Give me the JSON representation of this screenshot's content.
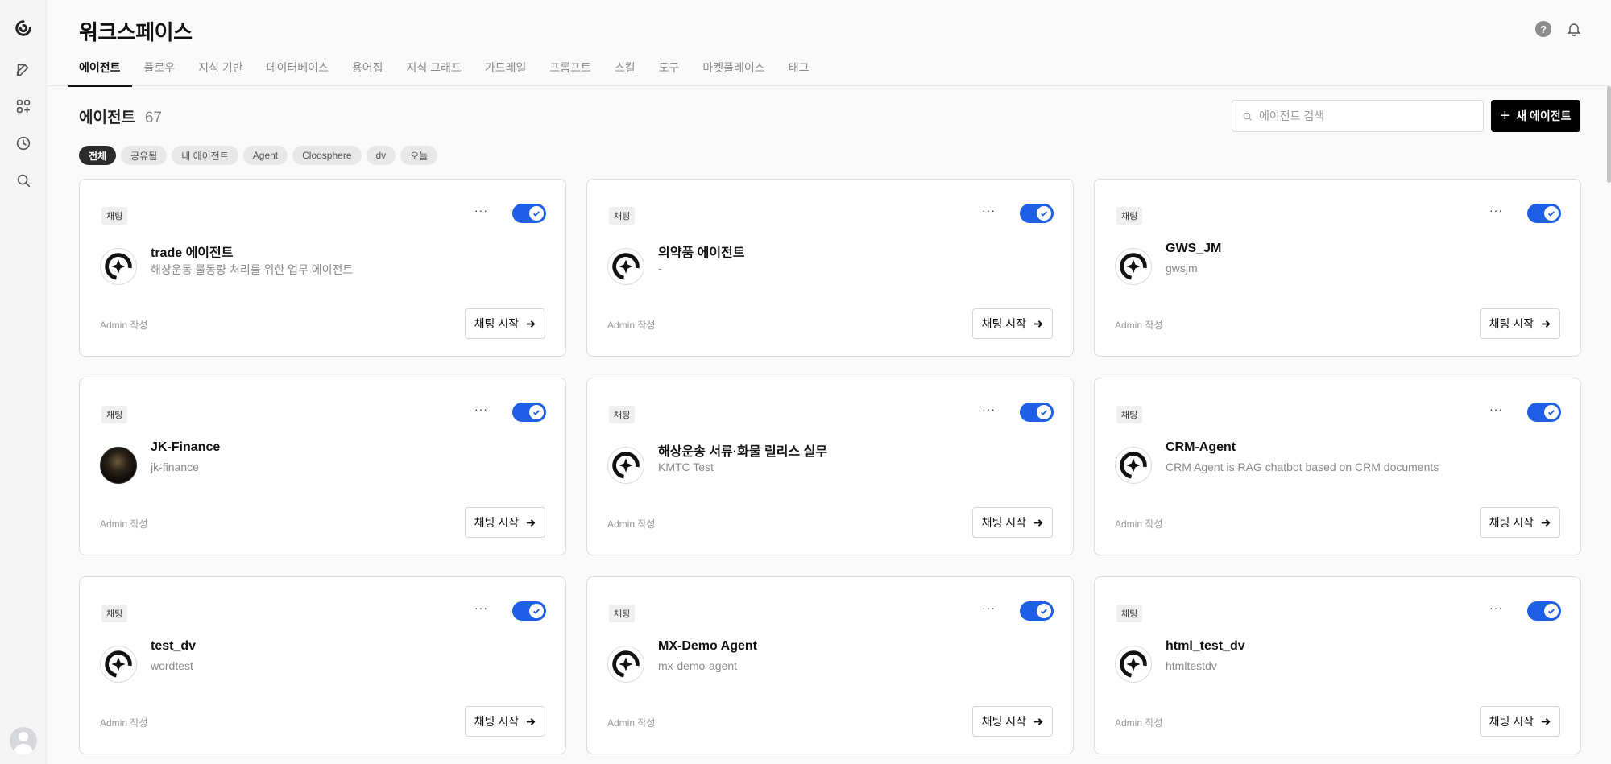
{
  "app": {
    "title": "워크스페이스"
  },
  "sidebar": {
    "icons": [
      "logo-icon",
      "edit-icon",
      "apps-icon",
      "history-icon",
      "search-icon"
    ]
  },
  "tabs": [
    {
      "label": "에이전트",
      "active": true
    },
    {
      "label": "플로우"
    },
    {
      "label": "지식 기반"
    },
    {
      "label": "데이터베이스"
    },
    {
      "label": "용어집"
    },
    {
      "label": "지식 그래프"
    },
    {
      "label": "가드레일"
    },
    {
      "label": "프롬프트"
    },
    {
      "label": "스킬"
    },
    {
      "label": "도구"
    },
    {
      "label": "마켓플레이스"
    },
    {
      "label": "태그"
    }
  ],
  "section": {
    "title": "에이전트",
    "count": "67"
  },
  "search": {
    "placeholder": "에이전트 검색",
    "value": ""
  },
  "new_button": {
    "label": "새 에이전트"
  },
  "filters": [
    {
      "label": "전체",
      "active": true
    },
    {
      "label": "공유됨"
    },
    {
      "label": "내 에이전트"
    },
    {
      "label": "Agent"
    },
    {
      "label": "Cloosphere"
    },
    {
      "label": "dv"
    },
    {
      "label": "오늘"
    }
  ],
  "cards": [
    {
      "tag": "채팅",
      "name": "trade 에이전트",
      "desc": "해상운동 물동량 처리를 위한 업무 에이전트",
      "author": "Admin 작성",
      "button": "채팅 시작",
      "enabled": true
    },
    {
      "tag": "채팅",
      "name": "의약품 에이전트",
      "desc": "-",
      "author": "Admin 작성",
      "button": "채팅 시작",
      "enabled": true
    },
    {
      "tag": "채팅",
      "name": "GWS_JM",
      "desc": "gwsjm",
      "author": "Admin 작성",
      "button": "채팅 시작",
      "enabled": true
    },
    {
      "tag": "채팅",
      "name": "JK-Finance",
      "desc": "jk-finance",
      "author": "Admin 작성",
      "button": "채팅 시작",
      "enabled": true,
      "photo": true
    },
    {
      "tag": "채팅",
      "name": "해상운송 서류·화물 릴리스 실무",
      "desc": "KMTC Test",
      "author": "Admin 작성",
      "button": "채팅 시작",
      "enabled": true
    },
    {
      "tag": "채팅",
      "name": "CRM-Agent",
      "desc": "CRM Agent is RAG chatbot based on CRM documents",
      "author": "Admin 작성",
      "button": "채팅 시작",
      "enabled": true
    },
    {
      "tag": "채팅",
      "name": "test_dv",
      "desc": "wordtest",
      "author": "Admin 작성",
      "button": "채팅 시작",
      "enabled": true
    },
    {
      "tag": "채팅",
      "name": "MX-Demo Agent",
      "desc": "mx-demo-agent",
      "author": "Admin 작성",
      "button": "채팅 시작",
      "enabled": true
    },
    {
      "tag": "채팅",
      "name": "html_test_dv",
      "desc": "htmltestdv",
      "author": "Admin 작성",
      "button": "채팅 시작",
      "enabled": true
    }
  ]
}
